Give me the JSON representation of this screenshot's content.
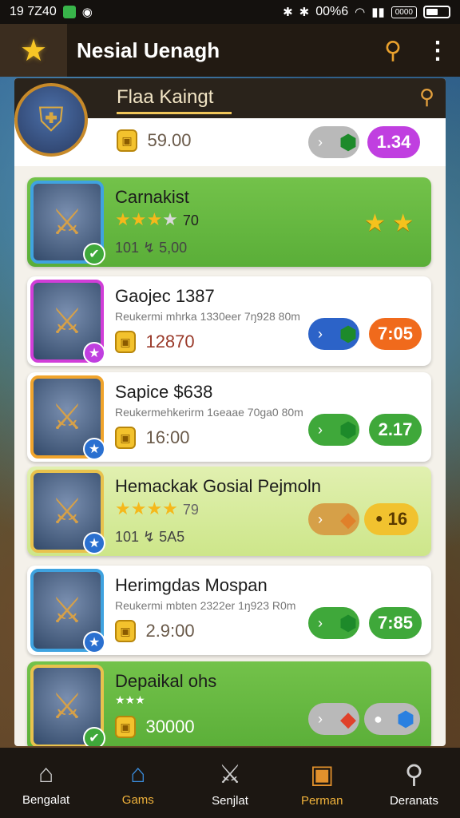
{
  "status": {
    "time": "19 7Z40",
    "battery_text": "00%6",
    "box": "0000"
  },
  "header": {
    "title": "Nesial Uenagh"
  },
  "sub_header": {
    "title": "Flaa Kaingt"
  },
  "top_row": {
    "price": "59.00",
    "pill": "1.34"
  },
  "cards": [
    {
      "title": "Carnakist",
      "rating": "70",
      "meta": "101 ↯ 5,00",
      "pill_color": "#f1c22f"
    },
    {
      "title": "Gaojec 1387",
      "subtitle": "Reukermi mhrka 1330eer 7ŋ928 80m",
      "price": "12870",
      "pill": "7:05",
      "pill_color": "#f06a1c"
    },
    {
      "title": "Sapice $638",
      "subtitle": "Reukermehkerirm 1ɢeaae 70ga0 80m",
      "price": "16:00",
      "pill": "2.17",
      "pill_color": "#3fa83a"
    },
    {
      "title": "Hemackak Gosial Pejmoln",
      "rating": "79",
      "meta": "101 ↯ 5A5",
      "pill": "16",
      "pill_color": "#f1c22f"
    },
    {
      "title": "Herimgdas Mospan",
      "subtitle": "Reukermi mbten 2322er 1ŋ923 R0m",
      "price": "2.9:00",
      "pill": "7:85",
      "pill_color": "#3fa83a"
    },
    {
      "title": "Depaikal ohs",
      "price": "30000"
    }
  ],
  "nav": [
    {
      "label": "Bengalat"
    },
    {
      "label": "Gams"
    },
    {
      "label": "Senjlat"
    },
    {
      "label": "Perman"
    },
    {
      "label": "Deranats"
    }
  ],
  "colors": {
    "accent": "#f0b23b",
    "green_card": "#5aae38",
    "purple_pill": "#c03fe0"
  }
}
